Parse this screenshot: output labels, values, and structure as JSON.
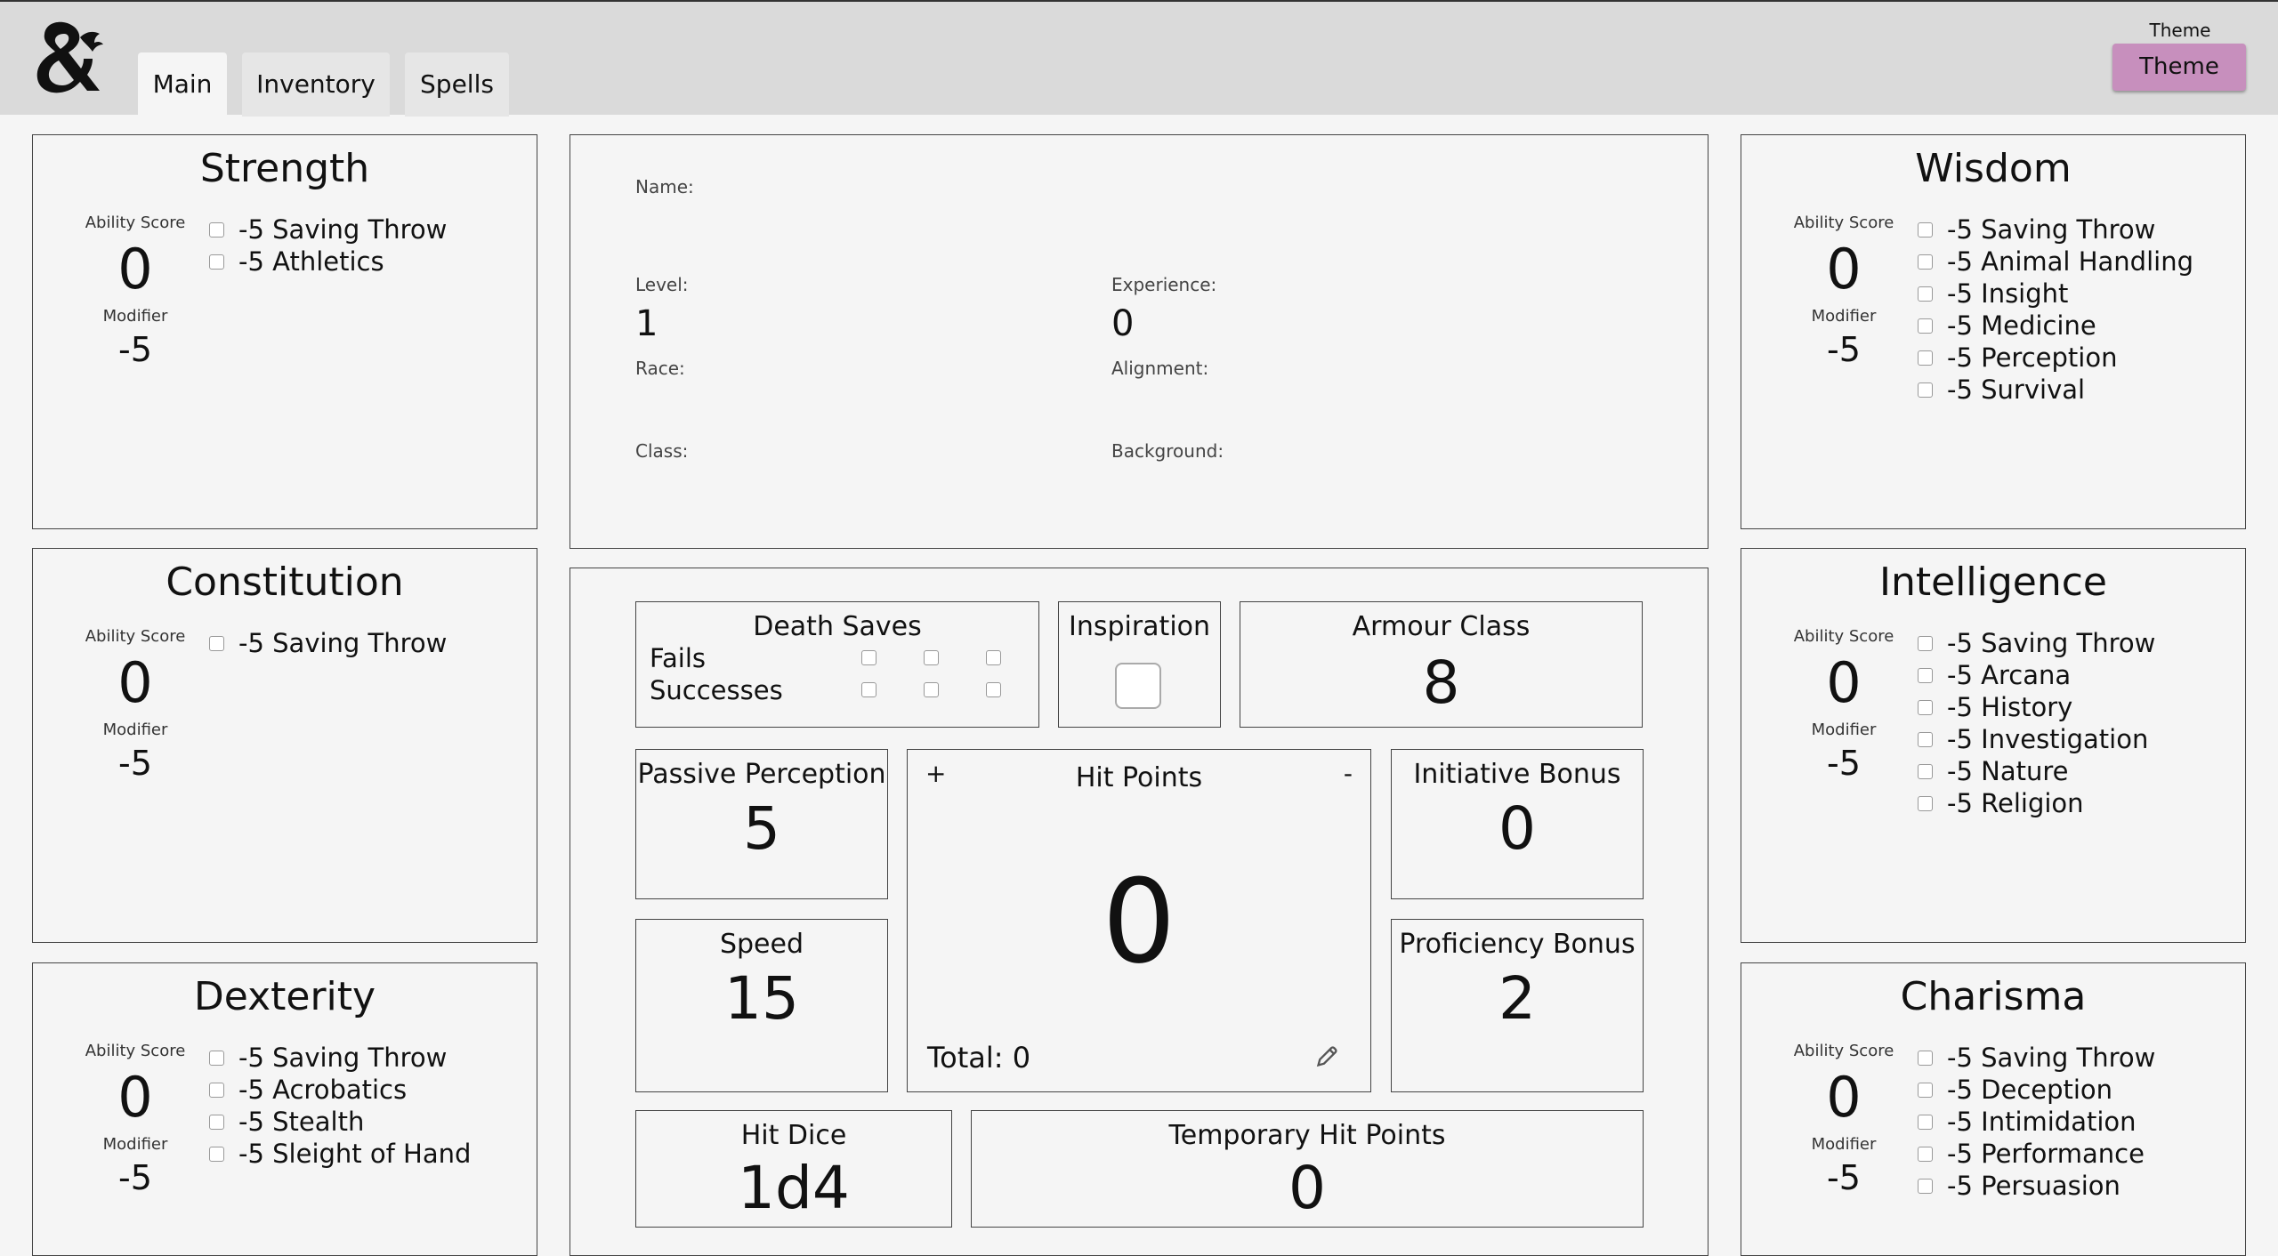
{
  "header": {
    "tabs": [
      {
        "label": "Main",
        "active": true
      },
      {
        "label": "Inventory",
        "active": false
      },
      {
        "label": "Spells",
        "active": false
      }
    ],
    "theme_label": "Theme",
    "theme_button": "Theme",
    "theme_button_color": "#c78fbd",
    "logo_icon": "dnd-ampersand-dragon-logo"
  },
  "labels": {
    "ability_score": "Ability Score",
    "modifier": "Modifier"
  },
  "abilities": {
    "strength": {
      "name": "Strength",
      "score": "0",
      "modifier": "-5",
      "skills": [
        {
          "mod": "-5",
          "name": "Saving Throw"
        },
        {
          "mod": "-5",
          "name": "Athletics"
        }
      ]
    },
    "constitution": {
      "name": "Constitution",
      "score": "0",
      "modifier": "-5",
      "skills": [
        {
          "mod": "-5",
          "name": "Saving Throw"
        }
      ]
    },
    "dexterity": {
      "name": "Dexterity",
      "score": "0",
      "modifier": "-5",
      "skills": [
        {
          "mod": "-5",
          "name": "Saving Throw"
        },
        {
          "mod": "-5",
          "name": "Acrobatics"
        },
        {
          "mod": "-5",
          "name": "Stealth"
        },
        {
          "mod": "-5",
          "name": "Sleight of Hand"
        }
      ]
    },
    "wisdom": {
      "name": "Wisdom",
      "score": "0",
      "modifier": "-5",
      "skills": [
        {
          "mod": "-5",
          "name": "Saving Throw"
        },
        {
          "mod": "-5",
          "name": "Animal Handling"
        },
        {
          "mod": "-5",
          "name": "Insight"
        },
        {
          "mod": "-5",
          "name": "Medicine"
        },
        {
          "mod": "-5",
          "name": "Perception"
        },
        {
          "mod": "-5",
          "name": "Survival"
        }
      ]
    },
    "intelligence": {
      "name": "Intelligence",
      "score": "0",
      "modifier": "-5",
      "skills": [
        {
          "mod": "-5",
          "name": "Saving Throw"
        },
        {
          "mod": "-5",
          "name": "Arcana"
        },
        {
          "mod": "-5",
          "name": "History"
        },
        {
          "mod": "-5",
          "name": "Investigation"
        },
        {
          "mod": "-5",
          "name": "Nature"
        },
        {
          "mod": "-5",
          "name": "Religion"
        }
      ]
    },
    "charisma": {
      "name": "Charisma",
      "score": "0",
      "modifier": "-5",
      "skills": [
        {
          "mod": "-5",
          "name": "Saving Throw"
        },
        {
          "mod": "-5",
          "name": "Deception"
        },
        {
          "mod": "-5",
          "name": "Intimidation"
        },
        {
          "mod": "-5",
          "name": "Performance"
        },
        {
          "mod": "-5",
          "name": "Persuasion"
        }
      ]
    }
  },
  "character": {
    "name_label": "Name:",
    "level_label": "Level:",
    "level": "1",
    "experience_label": "Experience:",
    "experience": "0",
    "race_label": "Race:",
    "alignment_label": "Alignment:",
    "class_label": "Class:",
    "background_label": "Background:"
  },
  "combat": {
    "death_saves": {
      "title": "Death Saves",
      "fails_label": "Fails",
      "successes_label": "Successes"
    },
    "inspiration": {
      "title": "Inspiration"
    },
    "armour_class": {
      "title": "Armour Class",
      "value": "8"
    },
    "passive_perception": {
      "title": "Passive Perception",
      "value": "5"
    },
    "speed": {
      "title": "Speed",
      "value": "15"
    },
    "hit_points": {
      "title": "Hit Points",
      "plus": "+",
      "minus": "-",
      "value": "0",
      "total": "Total: 0",
      "edit_icon": "pencil-icon"
    },
    "initiative_bonus": {
      "title": "Initiative Bonus",
      "value": "0"
    },
    "proficiency_bonus": {
      "title": "Proficiency Bonus",
      "value": "2"
    },
    "hit_dice": {
      "title": "Hit Dice",
      "value": "1d4"
    },
    "temp_hit_points": {
      "title": "Temporary Hit Points",
      "value": "0"
    }
  }
}
